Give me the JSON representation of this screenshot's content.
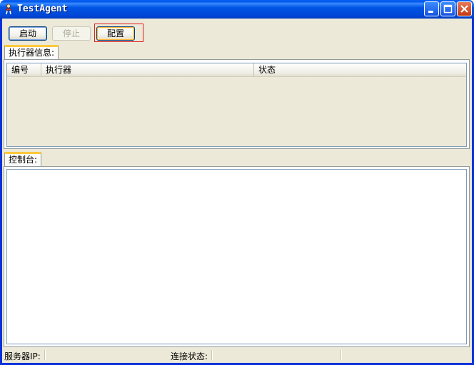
{
  "window": {
    "title": "TestAgent"
  },
  "toolbar": {
    "start_label": "启动",
    "stop_label": "停止",
    "config_label": "配置"
  },
  "executor_panel": {
    "tab_label": "执行器信息:",
    "columns": [
      "编号",
      "执行器",
      "状态"
    ],
    "rows": []
  },
  "console_panel": {
    "tab_label": "控制台:",
    "content": ""
  },
  "statusbar": {
    "server_ip_label": "服务器IP:",
    "connection_label": "连接状态:"
  },
  "colors": {
    "title_bar": "#0055e5",
    "close_button": "#c43a10",
    "highlight_box": "#e01d1d",
    "tab_accent": "#ffc83c"
  }
}
